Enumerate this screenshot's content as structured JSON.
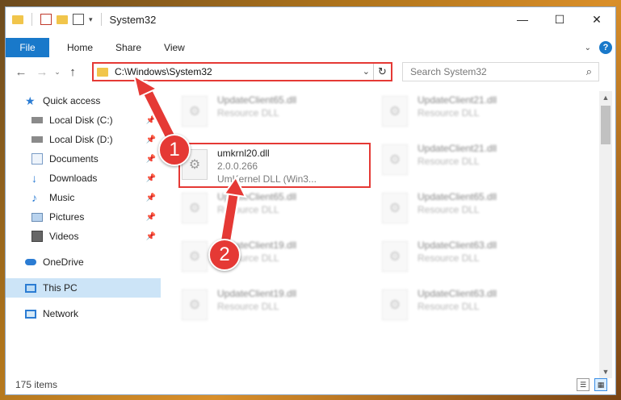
{
  "window": {
    "title": "System32"
  },
  "ribbon": {
    "tabs": [
      "File",
      "Home",
      "Share",
      "View"
    ]
  },
  "window_controls": {
    "minimize": "—",
    "maximize": "☐",
    "close": "✕"
  },
  "address": {
    "path": "C:\\Windows\\System32"
  },
  "search": {
    "placeholder": "Search System32"
  },
  "sidebar": {
    "items": [
      {
        "label": "Quick access",
        "icon": "star-icon"
      },
      {
        "label": "Local Disk (C:)",
        "icon": "drive-icon",
        "pinned": true
      },
      {
        "label": "Local Disk (D:)",
        "icon": "drive-icon",
        "pinned": true
      },
      {
        "label": "Documents",
        "icon": "documents-icon",
        "pinned": true
      },
      {
        "label": "Downloads",
        "icon": "download-icon",
        "pinned": true
      },
      {
        "label": "Music",
        "icon": "music-icon",
        "pinned": true
      },
      {
        "label": "Pictures",
        "icon": "pictures-icon",
        "pinned": true
      },
      {
        "label": "Videos",
        "icon": "videos-icon",
        "pinned": true
      },
      {
        "label": "OneDrive",
        "icon": "cloud-icon"
      },
      {
        "label": "This PC",
        "icon": "computer-icon",
        "selected": true
      },
      {
        "label": "Network",
        "icon": "network-icon"
      }
    ]
  },
  "files": {
    "highlighted": {
      "name": "umkrnl20.dll",
      "version": "2.0.0.266",
      "description": "UmKernel DLL   (Win3..."
    },
    "blurred": [
      {
        "name": "UpdateClient65.dll",
        "type": "Resource DLL"
      },
      {
        "name": "UpdateClient21.dll",
        "type": "Resource DLL"
      },
      {
        "name": "UpdateClient21.dll",
        "type": "Resource DLL"
      },
      {
        "name": "UpdateClient65.dll",
        "type": "Resource DLL"
      },
      {
        "name": "UpdateClient65.dll",
        "type": "Resource DLL"
      },
      {
        "name": "UpdateClient19.dll",
        "type": "Resource DLL"
      },
      {
        "name": "UpdateClient63.dll",
        "type": "Resource DLL"
      },
      {
        "name": "UpdateClient19.dll",
        "type": "Resource DLL"
      },
      {
        "name": "UpdateClient63.dll",
        "type": "Resource DLL"
      }
    ]
  },
  "status": {
    "item_count": "175 items"
  },
  "annotations": {
    "step1": "1",
    "step2": "2"
  },
  "colors": {
    "accent": "#1979ca",
    "annotation": "#e53935",
    "selected": "#cce4f7"
  }
}
